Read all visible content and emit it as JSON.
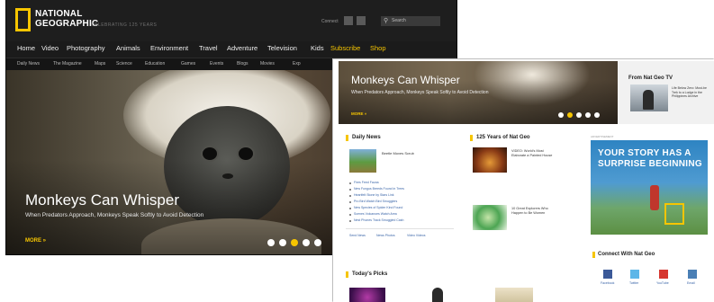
{
  "back": {
    "logo": {
      "line1": "NATIONAL",
      "line2": "GEOGRAPHIC",
      "tagline": "CELEBRATING 125 YEARS"
    },
    "connect_label": "Connect",
    "search": {
      "placeholder": "Search"
    },
    "nav": [
      "Home",
      "Video",
      "Photography",
      "Animals",
      "Environment",
      "Travel",
      "Adventure",
      "Television",
      "Kids",
      "Subscribe",
      "Shop"
    ],
    "nav_highlight": [
      "Subscribe",
      "Shop"
    ],
    "subnav": [
      "Daily News",
      "The Magazine",
      "Maps",
      "Science",
      "Education",
      "Games",
      "Events",
      "Blogs",
      "Movies",
      "Exp"
    ],
    "hero": {
      "title": "Monkeys Can Whisper",
      "subtitle": "When Predators Approach, Monkeys Speak Softly to Avoid Detection",
      "more": "MORE »",
      "dots": 5,
      "active_dot": 3
    }
  },
  "front": {
    "hero": {
      "title": "Monkeys Can Whisper",
      "subtitle": "When Predators Approach, Monkeys Speak Softly to Avoid Detection",
      "more": "MORE »",
      "dots": 5,
      "active_dot": 1
    },
    "tv": {
      "heading": "From Nat Geo TV",
      "description": "Life Below Zero: Must-be Trek to a Lodge in the Philippines Archive"
    },
    "daily_news": {
      "heading": "Daily News",
      "featured": "Beetle Moves Scrub",
      "links": [
        "Fires Feed Fauna",
        "New Fungus Breeds Found in Trees",
        "Heartfelt Stone by Stars Link",
        "Pro Bird Watch Bird Smugglers",
        "New Species of Spider Kind Found",
        "Scenes Volcanoes Watch Area",
        "Nest Phones Track Smuggled Cash"
      ],
      "footer_links": [
        "Send News",
        "News Photos",
        "Video Videos"
      ]
    },
    "years": {
      "heading": "125 Years of Nat Geo",
      "items": [
        {
          "title": "VIDEO: World's Most Elaborate a Painted House"
        },
        {
          "title": "10 Great Explorers Who Happen to Be Women"
        }
      ]
    },
    "ad": {
      "label": "ADVERTISEMENT",
      "line1": "YOUR STORY HAS A",
      "line2": "SURPRISE BEGINNING"
    },
    "connect": {
      "heading": "Connect With Nat Geo",
      "items": [
        {
          "name": "Facebook",
          "color": "#3b5998"
        },
        {
          "name": "Twitter",
          "color": "#5db6e8"
        },
        {
          "name": "YouTube",
          "color": "#d6362f"
        },
        {
          "name": "Email",
          "color": "#4a7fb5"
        }
      ]
    },
    "todays_picks": {
      "heading": "Today's Picks"
    }
  },
  "colors": {
    "accent": "#f6c500",
    "link": "#3a65a8",
    "dark_bg": "#1b1b1b"
  }
}
